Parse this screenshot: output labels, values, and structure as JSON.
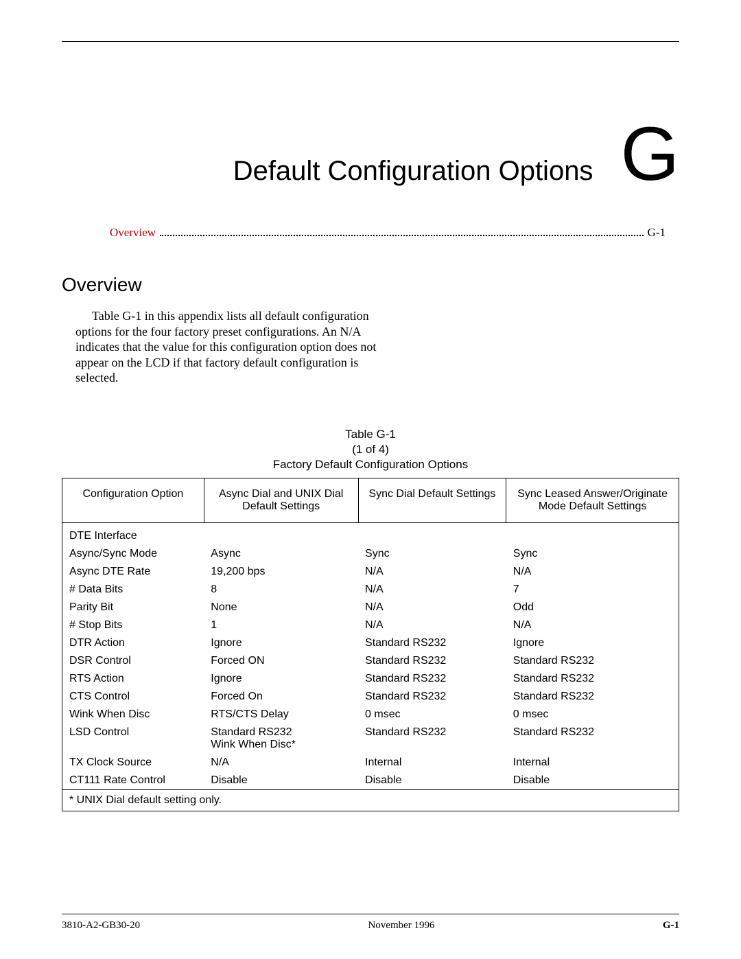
{
  "chapter": {
    "title": "Default Configuration Options",
    "letter": "G"
  },
  "toc": {
    "label": "Overview",
    "page": "G-1"
  },
  "section": {
    "heading": "Overview",
    "paragraph": "Table G-1 in this appendix lists all default configuration options for the four factory preset configurations. An N/A indicates that the value for this configuration option does not appear on the LCD if that factory default configuration is selected."
  },
  "table": {
    "caption_l1": "Table G-1",
    "caption_l2": "(1 of 4)",
    "caption_l3": "Factory Default Configuration Options",
    "headers": [
      "Configuration Option",
      "Async Dial and UNIX Dial Default Settings",
      "Sync Dial Default Settings",
      "Sync Leased Answer/Originate Mode Default Settings"
    ],
    "section_row": "DTE Interface",
    "rows": [
      {
        "option": "Async/Sync Mode",
        "c1": "Async",
        "c2": "Sync",
        "c3": "Sync"
      },
      {
        "option": "Async DTE Rate",
        "c1": "19,200 bps",
        "c2": "N/A",
        "c3": "N/A"
      },
      {
        "option": "# Data Bits",
        "c1": "8",
        "c2": "N/A",
        "c3": "7"
      },
      {
        "option": "Parity Bit",
        "c1": "None",
        "c2": "N/A",
        "c3": "Odd"
      },
      {
        "option": "# Stop Bits",
        "c1": "1",
        "c2": "N/A",
        "c3": "N/A"
      },
      {
        "option": "DTR Action",
        "c1": "Ignore",
        "c2": "Standard RS232",
        "c3": "Ignore"
      },
      {
        "option": "DSR Control",
        "c1": "Forced ON",
        "c2": "Standard RS232",
        "c3": "Standard RS232"
      },
      {
        "option": "RTS Action",
        "c1": "Ignore",
        "c2": "Standard RS232",
        "c3": "Standard RS232"
      },
      {
        "option": "CTS Control",
        "c1": "Forced On",
        "c2": "Standard RS232",
        "c3": "Standard RS232"
      },
      {
        "option": "Wink When Disc",
        "c1": "RTS/CTS Delay",
        "c2": "0 msec",
        "c3": "0 msec"
      },
      {
        "option": "LSD Control",
        "c1": "Standard RS232",
        "c1b": "Wink When Disc*",
        "c2": "Standard RS232",
        "c3": "Standard RS232"
      },
      {
        "option": "TX Clock Source",
        "c1": "N/A",
        "c2": "Internal",
        "c3": "Internal"
      },
      {
        "option": "CT111 Rate Control",
        "c1": "Disable",
        "c2": "Disable",
        "c3": "Disable"
      }
    ],
    "footnote": "* UNIX Dial default setting only."
  },
  "footer": {
    "left": "3810-A2-GB30-20",
    "center": "November 1996",
    "right": "G-1"
  }
}
